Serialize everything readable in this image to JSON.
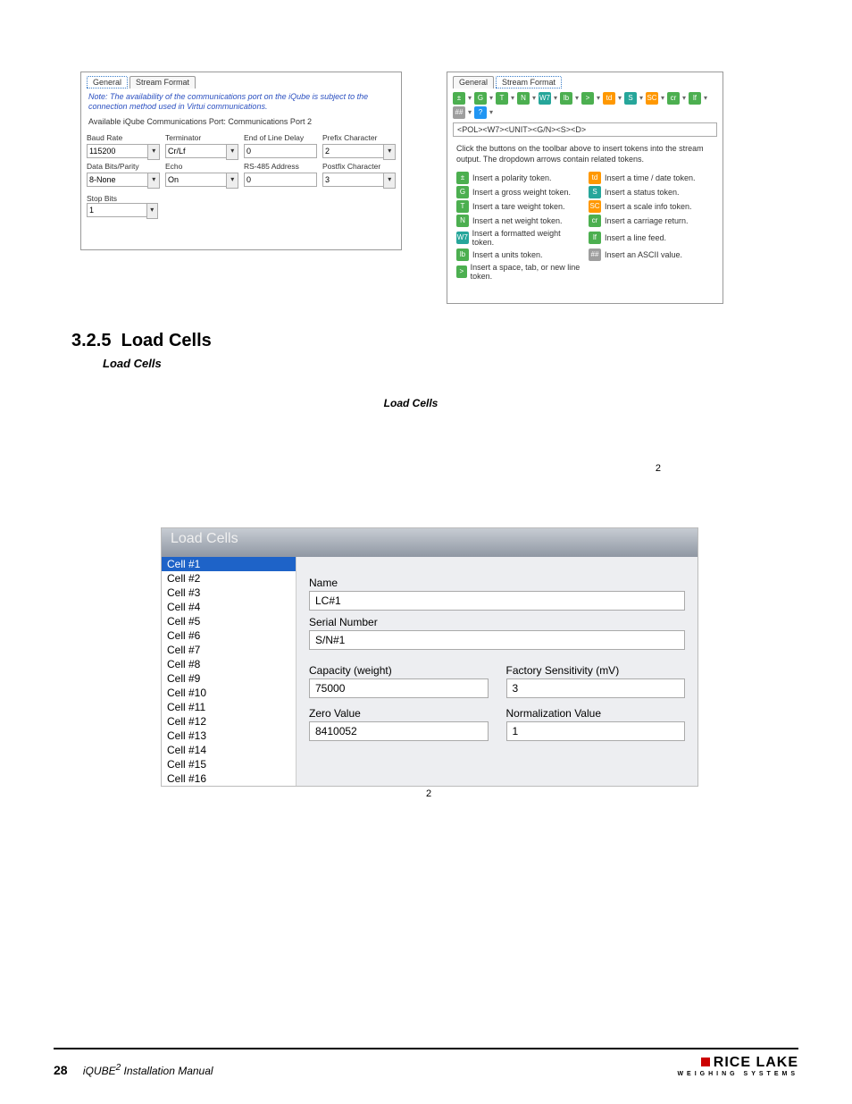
{
  "leftDialog": {
    "tabs": [
      "General",
      "Stream Format"
    ],
    "activeTab": 0,
    "note": "Note: The availability of the communications port on the iQube is subject to the connection method used in Virtui communications.",
    "avail": "Available iQube Communications Port:   Communications Port 2",
    "fields": {
      "baud": {
        "label": "Baud Rate",
        "value": "115200"
      },
      "term": {
        "label": "Terminator",
        "value": "Cr/Lf"
      },
      "eol": {
        "label": "End of Line Delay",
        "value": "0"
      },
      "prefix": {
        "label": "Prefix Character",
        "value": "2"
      },
      "databits": {
        "label": "Data Bits/Parity",
        "value": "8-None"
      },
      "echo": {
        "label": "Echo",
        "value": "On"
      },
      "rs485": {
        "label": "RS-485 Address",
        "value": "0"
      },
      "postfix": {
        "label": "Postfix Character",
        "value": "3"
      },
      "stop": {
        "label": "Stop Bits",
        "value": "1"
      }
    }
  },
  "rightDialog": {
    "tabs": [
      "General",
      "Stream Format"
    ],
    "activeTab": 1,
    "tokenString": "<POL><W7><UNIT><G/N><S><D>",
    "instructions": "Click the buttons on the toolbar above to insert tokens into the stream output. The dropdown arrows contain related tokens.",
    "toolbar": [
      {
        "g": "±",
        "c": "green"
      },
      {
        "g": "G",
        "c": "green"
      },
      {
        "g": "T",
        "c": "green"
      },
      {
        "g": "N",
        "c": "green"
      },
      {
        "g": "W7",
        "c": "teal"
      },
      {
        "g": "lb",
        "c": "green"
      },
      {
        "g": ">",
        "c": "green"
      },
      {
        "g": "td",
        "c": "orange"
      },
      {
        "g": "S",
        "c": "teal"
      },
      {
        "g": "SC",
        "c": "orange"
      },
      {
        "g": "cr",
        "c": "green"
      },
      {
        "g": "lf",
        "c": "green"
      },
      {
        "g": "##",
        "c": "grey"
      },
      {
        "g": "?",
        "c": "blue"
      }
    ],
    "legend": [
      {
        "icon": "±",
        "c": "green",
        "text": "Insert a polarity token."
      },
      {
        "icon": "td",
        "c": "orange",
        "text": "Insert a time / date token."
      },
      {
        "icon": "G",
        "c": "green",
        "text": "Insert a gross weight token."
      },
      {
        "icon": "S",
        "c": "teal",
        "text": "Insert a status token."
      },
      {
        "icon": "T",
        "c": "green",
        "text": "Insert a tare weight token."
      },
      {
        "icon": "SC",
        "c": "orange",
        "text": "Insert a scale info token."
      },
      {
        "icon": "N",
        "c": "green",
        "text": "Insert a net weight token."
      },
      {
        "icon": "cr",
        "c": "green",
        "text": "Insert a carriage return."
      },
      {
        "icon": "W7",
        "c": "teal",
        "text": "Insert a formatted weight token."
      },
      {
        "icon": "lf",
        "c": "green",
        "text": "Insert a line feed."
      },
      {
        "icon": "lb",
        "c": "green",
        "text": "Insert a units token."
      },
      {
        "icon": "##",
        "c": "grey",
        "text": "Insert an ASCII value."
      },
      {
        "icon": ">",
        "c": "green",
        "text": "Insert a space, tab, or new line token."
      }
    ]
  },
  "section": {
    "number": "3.2.5",
    "title": "Load Cells",
    "subtitle": "Load Cells",
    "caption": "Load Cells",
    "figureRef1": "2",
    "figureRef2": "2"
  },
  "loadCells": {
    "header": "Load Cells",
    "list": [
      "Cell #1",
      "Cell #2",
      "Cell #3",
      "Cell #4",
      "Cell #5",
      "Cell #6",
      "Cell #7",
      "Cell #8",
      "Cell #9",
      "Cell #10",
      "Cell #11",
      "Cell #12",
      "Cell #13",
      "Cell #14",
      "Cell #15",
      "Cell #16"
    ],
    "selectedIndex": 0,
    "fields": {
      "name": {
        "label": "Name",
        "value": "LC#1"
      },
      "serial": {
        "label": "Serial Number",
        "value": "S/N#1"
      },
      "capacity": {
        "label": "Capacity (weight)",
        "value": "75000"
      },
      "sensitivity": {
        "label": "Factory Sensitivity (mV)",
        "value": "3"
      },
      "zero": {
        "label": "Zero Value",
        "value": "8410052"
      },
      "norm": {
        "label": "Normalization Value",
        "value": "1"
      }
    }
  },
  "footer": {
    "page": "28",
    "product": "iQUBE",
    "sup": "2",
    "manual": " Installation Manual",
    "brand": "RICE LAKE",
    "brandsub": "WEIGHING SYSTEMS"
  }
}
